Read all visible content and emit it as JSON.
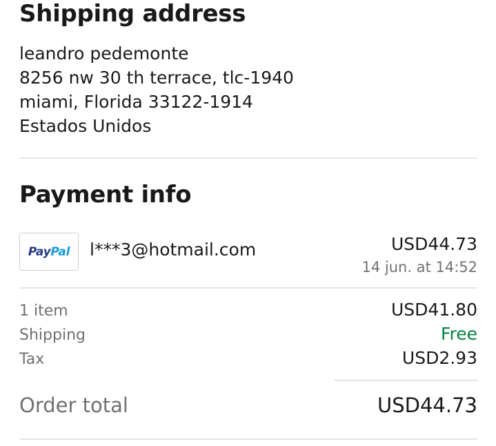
{
  "shipping": {
    "title": "Shipping address",
    "lines": [
      "leandro pedemonte",
      "8256 nw 30 th terrace, tlc-1940",
      "miami, Florida 33122-1914",
      "Estados Unidos"
    ]
  },
  "payment": {
    "title": "Payment info",
    "method": {
      "logo_text_1": "Pay",
      "logo_text_2": "Pal",
      "email": "l***3@hotmail.com",
      "amount": "USD44.73",
      "date": "14 jun. at 14:52"
    },
    "summary": {
      "items_label": "1 item",
      "items_value": "USD41.80",
      "shipping_label": "Shipping",
      "shipping_value": "Free",
      "tax_label": "Tax",
      "tax_value": "USD2.93"
    },
    "total": {
      "label": "Order total",
      "value": "USD44.73"
    }
  },
  "colors": {
    "text": "#191919",
    "muted": "#707070",
    "free": "#05823f",
    "divider": "#e5e5e5",
    "paypal_dark": "#253b80",
    "paypal_light": "#179bd7"
  }
}
